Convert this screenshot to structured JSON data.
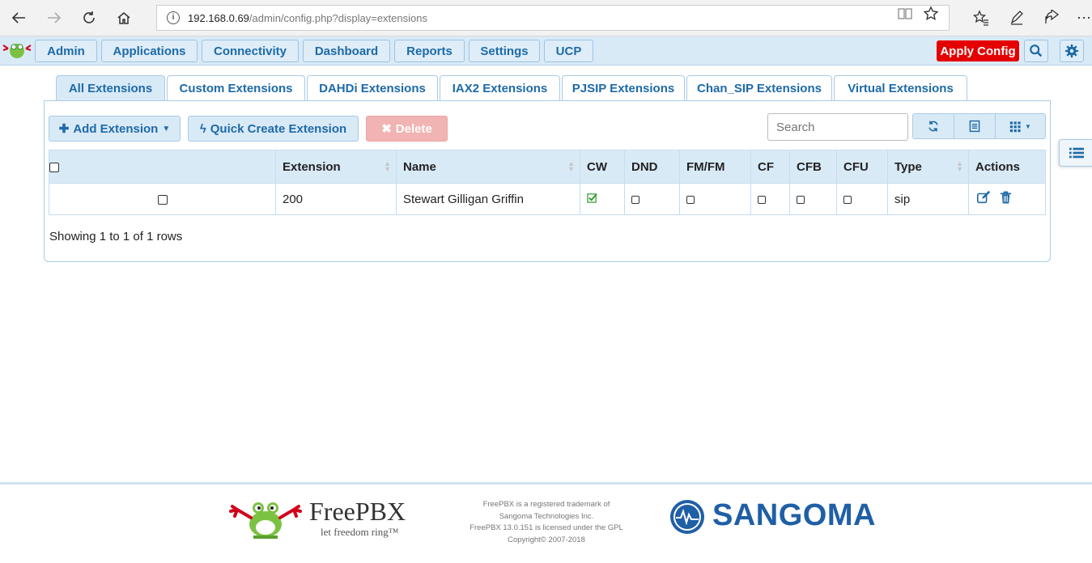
{
  "browser": {
    "url_host": "192.168.0.69",
    "url_path": "/admin/config.php?display=extensions"
  },
  "nav": {
    "items": [
      "Admin",
      "Applications",
      "Connectivity",
      "Dashboard",
      "Reports",
      "Settings",
      "UCP"
    ],
    "apply_label": "Apply Config",
    "apply_color": "#e50000"
  },
  "tabs": [
    "All Extensions",
    "Custom Extensions",
    "DAHDi Extensions",
    "IAX2 Extensions",
    "PJSIP Extensions",
    "Chan_SIP Extensions",
    "Virtual Extensions"
  ],
  "toolbar": {
    "add_label": "Add Extension",
    "quick_label": "Quick Create Extension",
    "delete_label": "Delete",
    "search_placeholder": "Search"
  },
  "table": {
    "headers": [
      "Extension",
      "Name",
      "CW",
      "DND",
      "FM/FM",
      "CF",
      "CFB",
      "CFU",
      "Type",
      "Actions"
    ],
    "rows": [
      {
        "extension": "200",
        "name": "Stewart Gilligan Griffin",
        "cw": true,
        "dnd": false,
        "fmfm": false,
        "cf": false,
        "cfb": false,
        "cfu": false,
        "type": "sip"
      }
    ],
    "row_info": "Showing 1 to 1 of 1 rows"
  },
  "footer": {
    "brand": "FreePBX",
    "tagline": "let freedom ring™",
    "legal": [
      "FreePBX is a registered trademark of",
      "Sangoma Technologies Inc.",
      "FreePBX 13.0.151 is licensed under the GPL",
      "Copyright© 2007-2018"
    ],
    "sangoma": "SANGOMA"
  }
}
